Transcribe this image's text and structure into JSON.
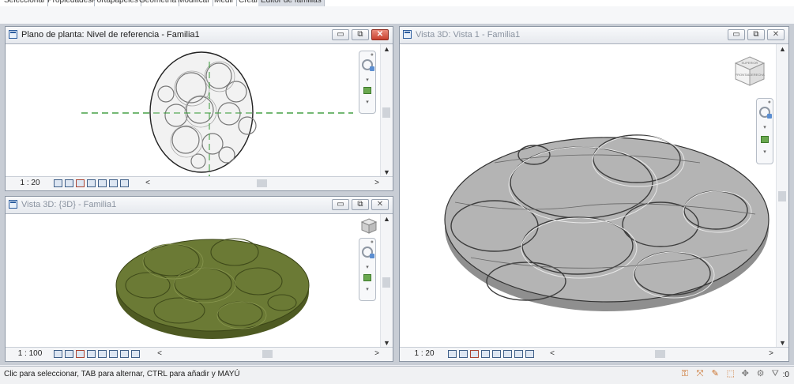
{
  "ribbon": {
    "tabs": [
      "Seleccionar",
      "Propiedades",
      "Portapapeles",
      "Geometría",
      "Modificar",
      "Medir",
      "Crear",
      "Editor de familias"
    ],
    "active_tab_index": 7
  },
  "views": {
    "plan": {
      "title": "Plano de planta: Nivel de referencia - Familia1",
      "scale": "1 : 20",
      "active": true,
      "buttons": {
        "minimize": "▭",
        "restore": "⧉",
        "close": "✕"
      }
    },
    "threeD": {
      "title": "Vista 3D: {3D} - Familia1",
      "scale": "1 : 100",
      "active": false,
      "buttons": {
        "minimize": "▭",
        "restore": "⧉",
        "close": "✕"
      }
    },
    "vista1": {
      "title": "Vista 3D: Vista 1 - Familia1",
      "scale": "1 : 20",
      "active": false,
      "buttons": {
        "minimize": "▭",
        "restore": "⧉",
        "close": "✕"
      }
    }
  },
  "viewcube": {
    "labels": [
      "SUPERIOR",
      "FRONTAL",
      "DERECHA"
    ]
  },
  "colors": {
    "terrain_green": "#6b7a35",
    "terrain_gray": "#b4b4b4",
    "plan_fill": "#f2f2f2",
    "reference_plane": "#3a9a3a"
  },
  "scroll": {
    "up": "▲",
    "down": "▼",
    "left": "<",
    "right": ">"
  },
  "nav_dropdown": "▾",
  "status": {
    "text": "Clic para seleccionar, TAB para alternar, CTRL para añadir y MAYÚ",
    "filter_count": ":0",
    "icons": [
      "link-select-icon",
      "underlay-select-icon",
      "pinned-select-icon",
      "face-select-icon",
      "drag-select-icon",
      "background-process-icon",
      "filter-icon"
    ]
  }
}
